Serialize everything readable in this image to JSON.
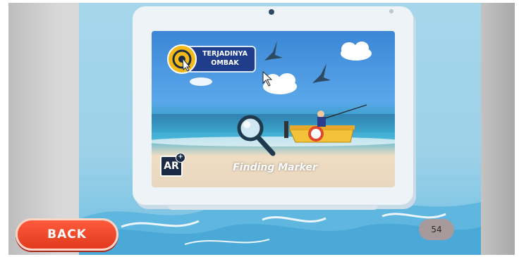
{
  "screen": {
    "topic_label": "TERJADINYA OMBAK",
    "ar_badge": "AR",
    "ar_badge_plus": "+",
    "status_text": "Finding Marker"
  },
  "controls": {
    "back_label": "BACK",
    "page_number": "54"
  },
  "icons": [
    "target-icon",
    "magnifier-icon",
    "ar-icon",
    "mouse-pointer-icon"
  ],
  "colors": {
    "back_button": "#e13a1e",
    "topic_pill": "#1f3d8a",
    "topic_icon": "#f2b918",
    "page_background": "#9dd1e8",
    "page_number_badge": "#a69a9c"
  }
}
